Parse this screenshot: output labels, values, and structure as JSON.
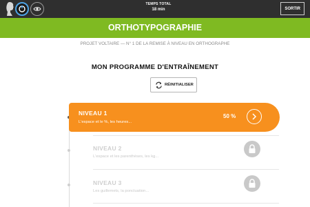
{
  "header": {
    "logo_text": "Voltaire",
    "timer_label": "TEMPS TOTAL",
    "timer_value": "18 min",
    "exit_label": "SORTIR"
  },
  "title_bar": {
    "title": "ORTHOTYPOGRAPHIE"
  },
  "subtitle": "PROJET VOLTAIRE — N° 1 DE LA REMISE À NIVEAU EN ORTHOGRAPHE",
  "program": {
    "heading": "MON PROGRAMME D'ENTRAÎNEMENT",
    "reset_label": "RÉINITIALISER"
  },
  "levels": [
    {
      "name": "NIVEAU 1",
      "description": "L'espace et le %, les heures...",
      "progress": "50 %",
      "state": "active"
    },
    {
      "name": "NIVEAU 2",
      "description": "L'espace et les parenthèses, les kg...",
      "state": "locked"
    },
    {
      "name": "NIVEAU 3",
      "description": "Les guillemets, la ponctuation...",
      "state": "locked"
    }
  ],
  "colors": {
    "topbar": "#2f2f2f",
    "green": "#7fba22",
    "orange": "#f7901e",
    "locked": "#c9c9c9"
  }
}
